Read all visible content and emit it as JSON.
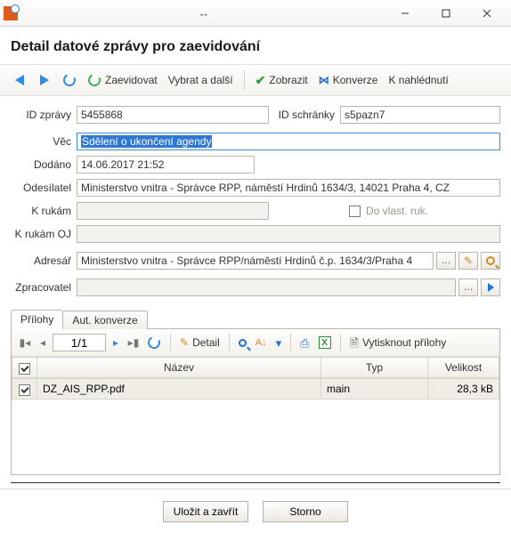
{
  "window": {
    "title": "Detail datové zprávy pro zaevidování",
    "app_title": "",
    "buttons": {
      "pin": "↔"
    }
  },
  "toolbar": {
    "zaevidovat": "Zaevidovat",
    "vybrat": "Vybrat a další",
    "zobrazit": "Zobrazit",
    "konverze": "Konverze",
    "nahlednuti": "K nahlédnutí"
  },
  "form": {
    "labels": {
      "id_zpravy": "ID zprávy",
      "id_schranky": "ID schránky",
      "vec": "Věc",
      "dodano": "Dodáno",
      "odesilatel": "Odesílatel",
      "k_rukam": "K rukám",
      "k_rukam_oj": "K rukám OJ",
      "adresar": "Adresář",
      "zpracovatel": "Zpracovatel",
      "do_vlast_ruk": "Do vlast. ruk."
    },
    "values": {
      "id_zpravy": "5455868",
      "id_schranky": "s5pazn7",
      "vec": "Sdělení o ukončení agendy",
      "dodano": "14.06.2017 21:52",
      "odesilatel": "Ministerstvo vnitra - Správce RPP, náměstí Hrdinů 1634/3, 14021 Praha 4, CZ",
      "k_rukam": "",
      "k_rukam_oj": "",
      "adresar": "Ministerstvo vnitra - Správce RPP/náměstí Hrdinů č.p. 1634/3/Praha 4",
      "zpracovatel": ""
    }
  },
  "tabs": {
    "prilohy": "Přílohy",
    "aut_konverze": "Aut. konverze"
  },
  "attachments": {
    "toolbar": {
      "page": "1/1",
      "detail": "Detail",
      "print": "Vytisknout přílohy"
    },
    "headers": {
      "nazev": "Název",
      "typ": "Typ",
      "velikost": "Velikost"
    },
    "rows": [
      {
        "checked": true,
        "nazev": "DZ_AIS_RPP.pdf",
        "typ": "main",
        "velikost": "28,3 kB"
      }
    ]
  },
  "footer": {
    "save": "Uložit a zavřít",
    "cancel": "Storno"
  }
}
